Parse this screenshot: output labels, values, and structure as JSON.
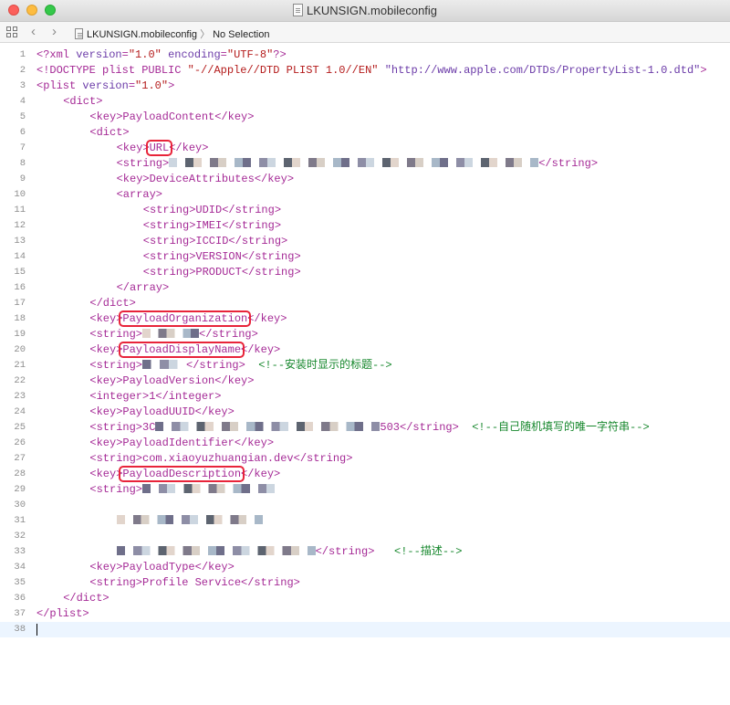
{
  "window": {
    "title": "LKUNSIGN.mobileconfig"
  },
  "jumpbar": {
    "file": "LKUNSIGN.mobileconfig",
    "selection": "No Selection"
  },
  "lines": [
    {
      "n": "1",
      "indent": 0,
      "tokens": [
        {
          "c": "tg",
          "t": "<?xml "
        },
        {
          "c": "an",
          "t": "version"
        },
        {
          "c": "tg",
          "t": "="
        },
        {
          "c": "av",
          "t": "\"1.0\""
        },
        {
          "c": "tg",
          "t": " "
        },
        {
          "c": "an",
          "t": "encoding"
        },
        {
          "c": "tg",
          "t": "="
        },
        {
          "c": "av",
          "t": "\"UTF-8\""
        },
        {
          "c": "tg",
          "t": "?>"
        }
      ]
    },
    {
      "n": "2",
      "indent": 0,
      "tokens": [
        {
          "c": "tg",
          "t": "<!DOCTYPE plist PUBLIC "
        },
        {
          "c": "av",
          "t": "\"-//Apple//DTD PLIST 1.0//EN\""
        },
        {
          "c": "tg",
          "t": " "
        },
        {
          "c": "an",
          "t": "\"http://www.apple.com/DTDs/PropertyList-1.0.dtd\""
        },
        {
          "c": "tg",
          "t": ">"
        }
      ]
    },
    {
      "n": "3",
      "indent": 0,
      "tokens": [
        {
          "c": "tg",
          "t": "<plist "
        },
        {
          "c": "an",
          "t": "version"
        },
        {
          "c": "tg",
          "t": "="
        },
        {
          "c": "av",
          "t": "\"1.0\""
        },
        {
          "c": "tg",
          "t": ">"
        }
      ]
    },
    {
      "n": "4",
      "indent": 1,
      "tokens": [
        {
          "c": "tg",
          "t": "<dict>"
        }
      ]
    },
    {
      "n": "5",
      "indent": 2,
      "tokens": [
        {
          "c": "tg",
          "t": "<key>"
        },
        {
          "c": "dt",
          "t": "PayloadContent"
        },
        {
          "c": "tg",
          "t": "</key>"
        }
      ]
    },
    {
      "n": "6",
      "indent": 2,
      "tokens": [
        {
          "c": "tg",
          "t": "<dict>"
        }
      ]
    },
    {
      "n": "7",
      "indent": 3,
      "tokens": [
        {
          "c": "tg",
          "t": "<key>"
        },
        {
          "c": "dt",
          "t": "URL"
        },
        {
          "c": "tg",
          "t": "</key>"
        }
      ]
    },
    {
      "n": "8",
      "indent": 3,
      "tokens": [
        {
          "c": "tg",
          "t": "<string>"
        },
        {
          "c": "redact",
          "w": 405
        },
        {
          "c": "tg",
          "t": "</string>"
        }
      ]
    },
    {
      "n": "9",
      "indent": 3,
      "tokens": [
        {
          "c": "tg",
          "t": "<key>"
        },
        {
          "c": "dt",
          "t": "DeviceAttributes"
        },
        {
          "c": "tg",
          "t": "</key>"
        }
      ]
    },
    {
      "n": "10",
      "indent": 3,
      "tokens": [
        {
          "c": "tg",
          "t": "<array>"
        }
      ]
    },
    {
      "n": "11",
      "indent": 4,
      "tokens": [
        {
          "c": "tg",
          "t": "<string>"
        },
        {
          "c": "dt",
          "t": "UDID"
        },
        {
          "c": "tg",
          "t": "</string>"
        }
      ]
    },
    {
      "n": "12",
      "indent": 4,
      "tokens": [
        {
          "c": "tg",
          "t": "<string>"
        },
        {
          "c": "dt",
          "t": "IMEI"
        },
        {
          "c": "tg",
          "t": "</string>"
        }
      ]
    },
    {
      "n": "13",
      "indent": 4,
      "tokens": [
        {
          "c": "tg",
          "t": "<string>"
        },
        {
          "c": "dt",
          "t": "ICCID"
        },
        {
          "c": "tg",
          "t": "</string>"
        }
      ]
    },
    {
      "n": "14",
      "indent": 4,
      "tokens": [
        {
          "c": "tg",
          "t": "<string>"
        },
        {
          "c": "dt",
          "t": "VERSION"
        },
        {
          "c": "tg",
          "t": "</string>"
        }
      ]
    },
    {
      "n": "15",
      "indent": 4,
      "tokens": [
        {
          "c": "tg",
          "t": "<string>"
        },
        {
          "c": "dt",
          "t": "PRODUCT"
        },
        {
          "c": "tg",
          "t": "</string>"
        }
      ]
    },
    {
      "n": "16",
      "indent": 3,
      "tokens": [
        {
          "c": "tg",
          "t": "</array>"
        }
      ]
    },
    {
      "n": "17",
      "indent": 2,
      "tokens": [
        {
          "c": "tg",
          "t": "</dict>"
        }
      ]
    },
    {
      "n": "18",
      "indent": 2,
      "tokens": [
        {
          "c": "tg",
          "t": "<key>"
        },
        {
          "c": "dt",
          "t": "PayloadOrganization"
        },
        {
          "c": "tg",
          "t": "</key>"
        }
      ]
    },
    {
      "n": "19",
      "indent": 2,
      "tokens": [
        {
          "c": "tg",
          "t": "<string>"
        },
        {
          "c": "redact",
          "w": 62
        },
        {
          "c": "tg",
          "t": "</string>"
        }
      ]
    },
    {
      "n": "20",
      "indent": 2,
      "tokens": [
        {
          "c": "tg",
          "t": "<key>"
        },
        {
          "c": "dt",
          "t": "PayloadDisplayName"
        },
        {
          "c": "tg",
          "t": "</key>"
        }
      ]
    },
    {
      "n": "21",
      "indent": 2,
      "tokens": [
        {
          "c": "tg",
          "t": "<string>"
        },
        {
          "c": "redact",
          "w": 48
        },
        {
          "c": "tg",
          "t": "</string>"
        },
        {
          "c": "cm",
          "t": "  <!--安装时显示的标题-->"
        }
      ]
    },
    {
      "n": "22",
      "indent": 2,
      "tokens": [
        {
          "c": "tg",
          "t": "<key>"
        },
        {
          "c": "dt",
          "t": "PayloadVersion"
        },
        {
          "c": "tg",
          "t": "</key>"
        }
      ]
    },
    {
      "n": "23",
      "indent": 2,
      "tokens": [
        {
          "c": "tg",
          "t": "<integer>"
        },
        {
          "c": "dt",
          "t": "1"
        },
        {
          "c": "tg",
          "t": "</integer>"
        }
      ]
    },
    {
      "n": "24",
      "indent": 2,
      "tokens": [
        {
          "c": "tg",
          "t": "<key>"
        },
        {
          "c": "dt",
          "t": "PayloadUUID"
        },
        {
          "c": "tg",
          "t": "</key>"
        }
      ]
    },
    {
      "n": "25",
      "indent": 2,
      "tokens": [
        {
          "c": "tg",
          "t": "<string>"
        },
        {
          "c": "dt",
          "t": "3C"
        },
        {
          "c": "redact",
          "w": 246
        },
        {
          "c": "dt",
          "t": "503"
        },
        {
          "c": "tg",
          "t": "</string>"
        },
        {
          "c": "cm",
          "t": "  <!--自己随机填写的唯一字符串-->"
        }
      ]
    },
    {
      "n": "26",
      "indent": 2,
      "tokens": [
        {
          "c": "tg",
          "t": "<key>"
        },
        {
          "c": "dt",
          "t": "PayloadIdentifier"
        },
        {
          "c": "tg",
          "t": "</key>"
        }
      ]
    },
    {
      "n": "27",
      "indent": 2,
      "tokens": [
        {
          "c": "tg",
          "t": "<string>"
        },
        {
          "c": "dt",
          "t": "com.xiaoyuzhuangian.dev"
        },
        {
          "c": "tg",
          "t": "</string>"
        }
      ]
    },
    {
      "n": "28",
      "indent": 2,
      "tokens": [
        {
          "c": "tg",
          "t": "<key>"
        },
        {
          "c": "dt",
          "t": "PayloadDescription"
        },
        {
          "c": "tg",
          "t": "</key>"
        }
      ]
    },
    {
      "n": "29",
      "indent": 2,
      "tokens": [
        {
          "c": "tg",
          "t": "<string>"
        },
        {
          "c": "redact",
          "w": 154
        }
      ]
    },
    {
      "n": "30",
      "indent": 0,
      "tokens": []
    },
    {
      "n": "31",
      "indent": 3,
      "tokens": [
        {
          "c": "redact",
          "w": 160
        }
      ]
    },
    {
      "n": "32",
      "indent": 0,
      "tokens": []
    },
    {
      "n": "33",
      "indent": 3,
      "tokens": [
        {
          "c": "redact",
          "w": 218
        },
        {
          "c": "tg",
          "t": "</string>"
        },
        {
          "c": "cm",
          "t": "   <!--描述-->"
        }
      ]
    },
    {
      "n": "34",
      "indent": 2,
      "tokens": [
        {
          "c": "tg",
          "t": "<key>"
        },
        {
          "c": "dt",
          "t": "PayloadType"
        },
        {
          "c": "tg",
          "t": "</key>"
        }
      ]
    },
    {
      "n": "35",
      "indent": 2,
      "tokens": [
        {
          "c": "tg",
          "t": "<string>"
        },
        {
          "c": "dt",
          "t": "Profile Service"
        },
        {
          "c": "tg",
          "t": "</string>"
        }
      ]
    },
    {
      "n": "36",
      "indent": 1,
      "tokens": [
        {
          "c": "tg",
          "t": "</dict>"
        }
      ]
    },
    {
      "n": "37",
      "indent": 0,
      "tokens": [
        {
          "c": "tg",
          "t": "</plist>"
        }
      ]
    },
    {
      "n": "38",
      "indent": 0,
      "tokens": [],
      "current": true
    }
  ],
  "highlights": [
    "URL",
    "PayloadOrganization",
    "PayloadDisplayName",
    "PayloadDescription"
  ],
  "colors": {
    "tag": "#a52a96",
    "attr_value": "#b41b1b",
    "comment": "#16872c",
    "highlight_box": "#e8243a"
  }
}
